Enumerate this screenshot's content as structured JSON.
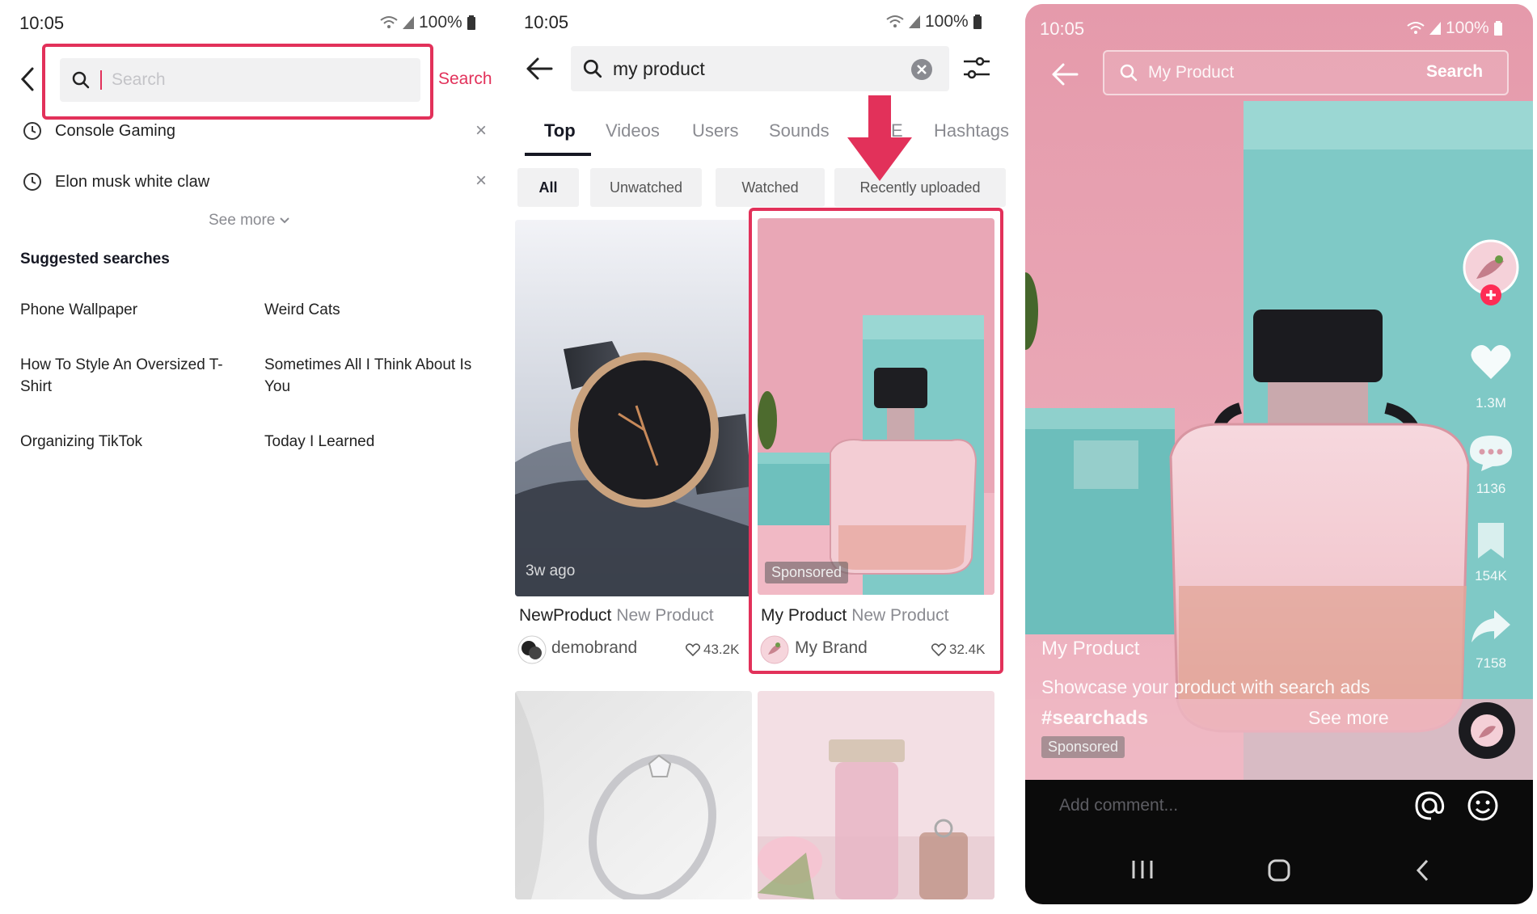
{
  "panel1": {
    "status": {
      "time": "10:05",
      "battery": "100%"
    },
    "search": {
      "placeholder": "Search",
      "action_label": "Search"
    },
    "history": [
      {
        "label": "Console Gaming"
      },
      {
        "label": "Elon musk white claw"
      }
    ],
    "see_more": "See more",
    "suggested_title": "Suggested searches",
    "suggestions": [
      "Phone Wallpaper",
      "Weird Cats",
      "How To Style An Oversized T-Shirt",
      "Sometimes All I Think About Is You",
      "Organizing TikTok",
      "Today I Learned"
    ]
  },
  "panel2": {
    "status": {
      "time": "10:05",
      "battery": "100%"
    },
    "search": {
      "value": "my product"
    },
    "tabs": [
      "Top",
      "Videos",
      "Users",
      "Sounds",
      "E",
      "Hashtags"
    ],
    "chips": [
      "All",
      "Unwatched",
      "Watched",
      "Recently uploaded"
    ],
    "cards": [
      {
        "age": "3w ago",
        "title": "NewProduct",
        "subtitle": "New Product",
        "author": "demobrand",
        "likes": "43.2K"
      },
      {
        "badge": "Sponsored",
        "title": "My Product",
        "subtitle": "New Product",
        "author": "My Brand",
        "likes": "32.4K"
      }
    ]
  },
  "panel3": {
    "status": {
      "time": "10:05",
      "battery": "100%"
    },
    "search": {
      "value": "My Product",
      "action_label": "Search"
    },
    "counts": {
      "likes": "1.3M",
      "comments": "1136",
      "saves": "154K",
      "shares": "7158"
    },
    "caption": {
      "title": "My Product",
      "text": "Showcase your product with search ads",
      "hashtag": "#searchads",
      "see_more": "See more",
      "badge": "Sponsored"
    },
    "comment_placeholder": "Add comment..."
  },
  "colors": {
    "highlight": "#e2315a",
    "tiktok_pink": "#fe2c55",
    "teal": "#73c5c4",
    "backdrop_pink": "#e8a4b2"
  }
}
